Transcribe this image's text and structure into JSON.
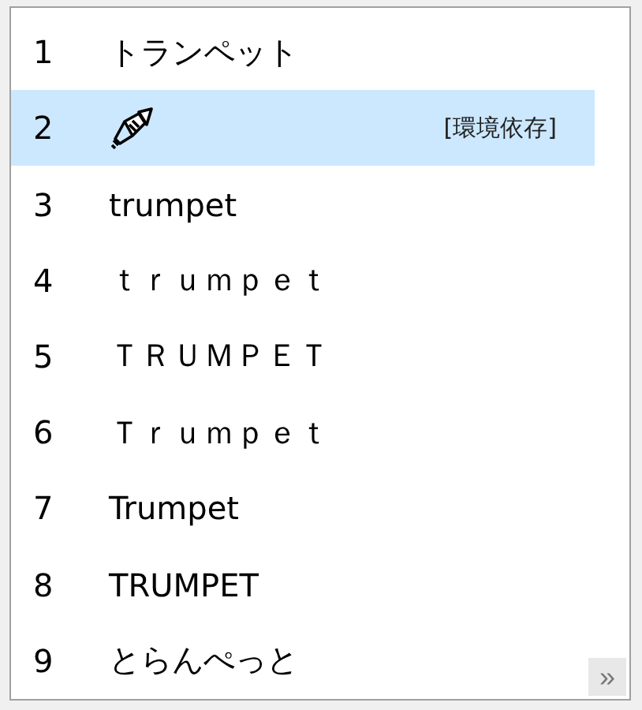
{
  "candidates": [
    {
      "number": "1",
      "kind": "text",
      "text": "トランペット",
      "selected": false
    },
    {
      "number": "2",
      "kind": "emoji",
      "annotation": "[環境依存]",
      "selected": true
    },
    {
      "number": "3",
      "kind": "text",
      "text": "trumpet",
      "selected": false
    },
    {
      "number": "4",
      "kind": "text",
      "text": "ｔｒｕｍｐｅｔ",
      "selected": false
    },
    {
      "number": "5",
      "kind": "text",
      "text": "ＴＲＵＭＰＥＴ",
      "selected": false
    },
    {
      "number": "6",
      "kind": "text",
      "text": "Ｔｒｕｍｐｅｔ",
      "selected": false
    },
    {
      "number": "7",
      "kind": "text",
      "text": "Trumpet",
      "selected": false
    },
    {
      "number": "8",
      "kind": "text",
      "text": "TRUMPET",
      "selected": false
    },
    {
      "number": "9",
      "kind": "text",
      "text": "とらんぺっと",
      "selected": false
    }
  ],
  "expand_button": {
    "label": "»"
  }
}
